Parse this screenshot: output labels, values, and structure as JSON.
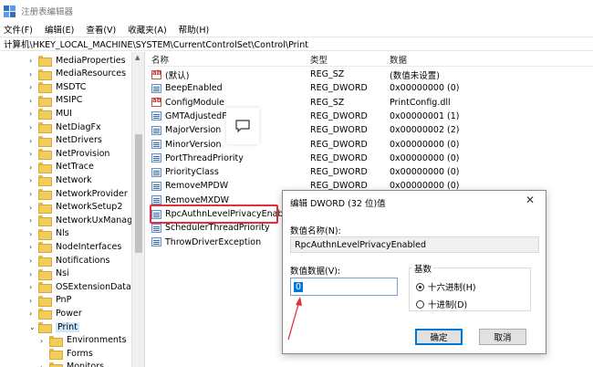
{
  "window": {
    "title": "注册表编辑器"
  },
  "menu": [
    "文件(F)",
    "编辑(E)",
    "查看(V)",
    "收藏夹(A)",
    "帮助(H)"
  ],
  "address": "计算机\\HKEY_LOCAL_MACHINE\\SYSTEM\\CurrentControlSet\\Control\\Print",
  "tree": {
    "items": [
      {
        "label": "MediaProperties",
        "expandable": true
      },
      {
        "label": "MediaResources",
        "expandable": true
      },
      {
        "label": "MSDTC",
        "expandable": true
      },
      {
        "label": "MSIPC",
        "expandable": true
      },
      {
        "label": "MUI",
        "expandable": true
      },
      {
        "label": "NetDiagFx",
        "expandable": true
      },
      {
        "label": "NetDrivers",
        "expandable": true
      },
      {
        "label": "NetProvision",
        "expandable": true
      },
      {
        "label": "NetTrace",
        "expandable": true
      },
      {
        "label": "Network",
        "expandable": true
      },
      {
        "label": "NetworkProvider",
        "expandable": true
      },
      {
        "label": "NetworkSetup2",
        "expandable": true
      },
      {
        "label": "NetworkUxManager",
        "expandable": true
      },
      {
        "label": "Nls",
        "expandable": true
      },
      {
        "label": "NodeInterfaces",
        "expandable": true
      },
      {
        "label": "Notifications",
        "expandable": true
      },
      {
        "label": "Nsi",
        "expandable": true
      },
      {
        "label": "OSExtensionDatabase",
        "expandable": true
      },
      {
        "label": "PnP",
        "expandable": true
      },
      {
        "label": "Power",
        "expandable": true
      },
      {
        "label": "Print",
        "expandable": true,
        "expanded": true,
        "selected": true
      },
      {
        "label": "Environments",
        "expandable": true,
        "child": true
      },
      {
        "label": "Forms",
        "expandable": false,
        "child": true
      },
      {
        "label": "Monitors",
        "expandable": true,
        "child": true
      }
    ]
  },
  "columns": {
    "name": "名称",
    "type": "类型",
    "data": "数据"
  },
  "values": [
    {
      "name": "(默认)",
      "type": "REG_SZ",
      "data": "(数值未设置)",
      "kind": "sz"
    },
    {
      "name": "BeepEnabled",
      "type": "REG_DWORD",
      "data": "0x00000000 (0)",
      "kind": "dw"
    },
    {
      "name": "ConfigModule",
      "type": "REG_SZ",
      "data": "PrintConfig.dll",
      "kind": "sz"
    },
    {
      "name": "GMTAdjustedForDST",
      "type": "REG_DWORD",
      "data": "0x00000001 (1)",
      "kind": "dw"
    },
    {
      "name": "MajorVersion",
      "type": "REG_DWORD",
      "data": "0x00000002 (2)",
      "kind": "dw"
    },
    {
      "name": "MinorVersion",
      "type": "REG_DWORD",
      "data": "0x00000000 (0)",
      "kind": "dw"
    },
    {
      "name": "PortThreadPriority",
      "type": "REG_DWORD",
      "data": "0x00000000 (0)",
      "kind": "dw"
    },
    {
      "name": "PriorityClass",
      "type": "REG_DWORD",
      "data": "0x00000000 (0)",
      "kind": "dw"
    },
    {
      "name": "RemoveMPDW",
      "type": "REG_DWORD",
      "data": "0x00000000 (0)",
      "kind": "dw"
    },
    {
      "name": "RemoveMXDW",
      "type": "",
      "data": "",
      "kind": "dw"
    },
    {
      "name": "RpcAuthnLevelPrivacyEnabled",
      "type": "",
      "data": "",
      "kind": "dw"
    },
    {
      "name": "SchedulerThreadPriority",
      "type": "",
      "data": "",
      "kind": "dw"
    },
    {
      "name": "ThrowDriverException",
      "type": "",
      "data": "",
      "kind": "dw"
    }
  ],
  "dialog": {
    "title": "编辑 DWORD (32 位)值",
    "close": "✕",
    "name_label": "数值名称(N):",
    "name_value": "RpcAuthnLevelPrivacyEnabled",
    "data_label": "数值数据(V):",
    "data_value": "0",
    "base_label": "基数",
    "radio_hex": "十六进制(H)",
    "radio_dec": "十进制(D)",
    "hex_selected": true,
    "ok": "确定",
    "cancel": "取消"
  },
  "colors": {
    "highlight": "#e0303a",
    "selection": "#cce8ff",
    "accent": "#0078d7"
  }
}
